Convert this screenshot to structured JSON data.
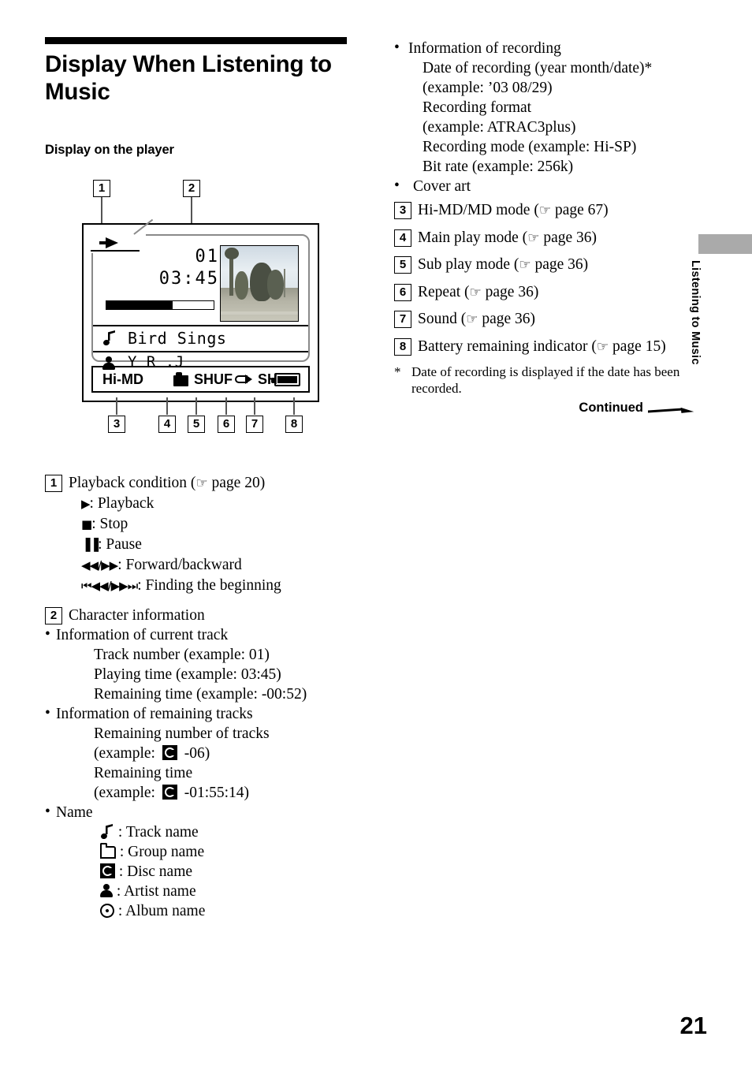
{
  "page": {
    "number": "21",
    "side_tab": "Listening to Music",
    "continued": "Continued"
  },
  "header": {
    "title": "Display When Listening to Music",
    "subtitle": "Display on the player"
  },
  "diagram": {
    "callouts": [
      "1",
      "2",
      "3",
      "4",
      "5",
      "6",
      "7",
      "8"
    ],
    "lcd": {
      "track_number": "01",
      "playing_time": "03:45",
      "progress_percent": 62,
      "track_name": "Bird Sings",
      "track_name_icon": "music-note-icon",
      "artist_name": "Y R .J",
      "artist_name_icon": "person-icon",
      "cover_art_alt": "Cover art photo of trees in a park",
      "playback_icon": "play-arrow-icon"
    },
    "status_bar": {
      "mode": "Hi-MD",
      "main_play_mode_icon": "folder-solid-icon",
      "sub_play_mode": "SHUF",
      "repeat_icon": "repeat-arrow-icon",
      "sound": "SH",
      "battery_icon": "battery-full-icon"
    }
  },
  "left_column": {
    "item1": {
      "number": "1",
      "heading": "Playback condition (",
      "heading_ref": " page 20)",
      "hand": "☞",
      "lines": [
        {
          "glyph": "▶",
          "text": ": Playback"
        },
        {
          "glyph": "■",
          "text": ": Stop"
        },
        {
          "glyph": "▐▐",
          "text": ": Pause"
        },
        {
          "glyph": "◀◀/▶▶",
          "text": ": Forward/backward"
        },
        {
          "glyph": "⏮◀◀/▶▶⏭",
          "text": ": Finding the beginning"
        }
      ]
    },
    "item2": {
      "number": "2",
      "heading": "Character information",
      "groups": [
        {
          "bullet": "Information of current track",
          "lines": [
            "Track number (example: 01)",
            "Playing time (example: 03:45)",
            "Remaining time (example: -00:52)"
          ]
        },
        {
          "bullet": "Information of remaining tracks",
          "lines": [
            "Remaining number of tracks",
            "(example: [disc] -06)",
            "Remaining time",
            "(example: [disc] -01:55:14)"
          ],
          "line_parts": [
            {
              "text": "Remaining number of tracks"
            },
            {
              "pre": "(example:",
              "icon": "disc-icon",
              "post": "-06)"
            },
            {
              "text": "Remaining time"
            },
            {
              "pre": "(example:",
              "icon": "disc-icon",
              "post": "-01:55:14)"
            }
          ]
        },
        {
          "bullet": "Name",
          "icon_lines": [
            {
              "icon": "music-note-icon",
              "text": ": Track name"
            },
            {
              "icon": "folder-icon",
              "text": ": Group name"
            },
            {
              "icon": "disc-icon",
              "text": ": Disc name"
            },
            {
              "icon": "person-icon",
              "text": ": Artist name"
            },
            {
              "icon": "album-icon",
              "text": ": Album name"
            }
          ]
        }
      ]
    }
  },
  "right_column": {
    "recording_group": {
      "bullet": "Information of recording",
      "lines": [
        "Date of recording (year month/date)*",
        "(example: ’03 08/29)",
        "Recording format",
        "(example: ATRAC3plus)",
        "Recording mode (example: Hi-SP)",
        "Bit rate (example: 256k)"
      ]
    },
    "cover_art_bullet": "Cover art",
    "numbered": [
      {
        "number": "3",
        "pre": "Hi-MD/MD mode (",
        "hand": "☞",
        "post": " page 67)"
      },
      {
        "number": "4",
        "pre": "Main play mode (",
        "hand": "☞",
        "post": " page 36)"
      },
      {
        "number": "5",
        "pre": "Sub play mode  (",
        "hand": "☞",
        "post": " page 36)"
      },
      {
        "number": "6",
        "pre": "Repeat (",
        "hand": "☞",
        "post": " page 36)"
      },
      {
        "number": "7",
        "pre": "Sound (",
        "hand": "☞",
        "post": " page 36)"
      },
      {
        "number": "8",
        "pre": "Battery remaining indicator (",
        "hand": "☞",
        "post": " page 15)"
      }
    ],
    "footnote": {
      "star": "*",
      "text": "Date of recording is displayed if the date has been recorded."
    }
  }
}
